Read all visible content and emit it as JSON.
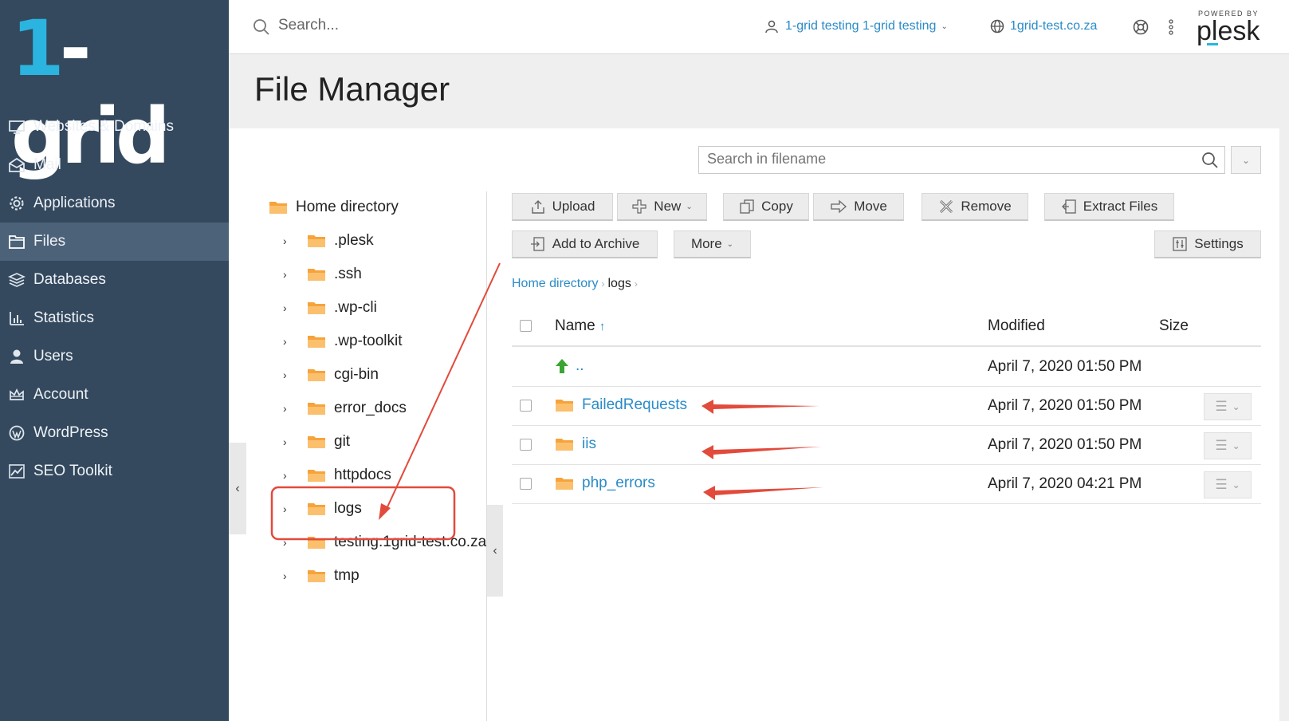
{
  "brand": {
    "logo_prefix": "1",
    "logo_rest": "-grid",
    "accent": "#2bb4e0"
  },
  "sidebar": {
    "items": [
      {
        "label": "Websites & Domains",
        "icon": "monitor-icon",
        "active": false
      },
      {
        "label": "Mail",
        "icon": "mail-icon",
        "active": false
      },
      {
        "label": "Applications",
        "icon": "gear-icon",
        "active": false
      },
      {
        "label": "Files",
        "icon": "folder-icon",
        "active": true
      },
      {
        "label": "Databases",
        "icon": "database-icon",
        "active": false
      },
      {
        "label": "Statistics",
        "icon": "bar-chart-icon",
        "active": false
      },
      {
        "label": "Users",
        "icon": "user-icon",
        "active": false
      },
      {
        "label": "Account",
        "icon": "crown-icon",
        "active": false
      },
      {
        "label": "WordPress",
        "icon": "wordpress-icon",
        "active": false
      },
      {
        "label": "SEO Toolkit",
        "icon": "seo-chart-icon",
        "active": false
      }
    ],
    "collapse_glyph": "‹"
  },
  "topbar": {
    "search_placeholder": "Search...",
    "user_label": "1-grid testing 1-grid testing",
    "domain_label": "1grid-test.co.za",
    "powered_by": "POWERED BY",
    "plesk": "plesk"
  },
  "page": {
    "title": "File Manager"
  },
  "filename_search": {
    "placeholder": "Search in filename"
  },
  "tree": {
    "root": "Home directory",
    "items": [
      ".plesk",
      ".ssh",
      ".wp-cli",
      ".wp-toolkit",
      "cgi-bin",
      "error_docs",
      "git",
      "httpdocs",
      "logs",
      "testing.1grid-test.co.za",
      "tmp"
    ],
    "collapse_glyph": "‹"
  },
  "toolbar": {
    "upload": "Upload",
    "new": "New",
    "copy": "Copy",
    "move": "Move",
    "remove": "Remove",
    "extract": "Extract Files",
    "add_archive": "Add to Archive",
    "more": "More",
    "settings": "Settings"
  },
  "breadcrumb": {
    "home": "Home directory",
    "current": "logs"
  },
  "table": {
    "headers": {
      "name": "Name",
      "sort": "↑",
      "modified": "Modified",
      "size": "Size"
    },
    "parent": {
      "name": "..",
      "modified": "April 7, 2020 01:50 PM"
    },
    "rows": [
      {
        "name": "FailedRequests",
        "modified": "April 7, 2020 01:50 PM"
      },
      {
        "name": "iis",
        "modified": "April 7, 2020 01:50 PM"
      },
      {
        "name": "php_errors",
        "modified": "April 7, 2020 04:21 PM"
      }
    ]
  },
  "colors": {
    "sidebar_bg": "#34495e",
    "sidebar_active": "#4c6279",
    "link": "#2a8bc7",
    "folder": "#f7a33c",
    "annotation": "#e24a3b"
  }
}
